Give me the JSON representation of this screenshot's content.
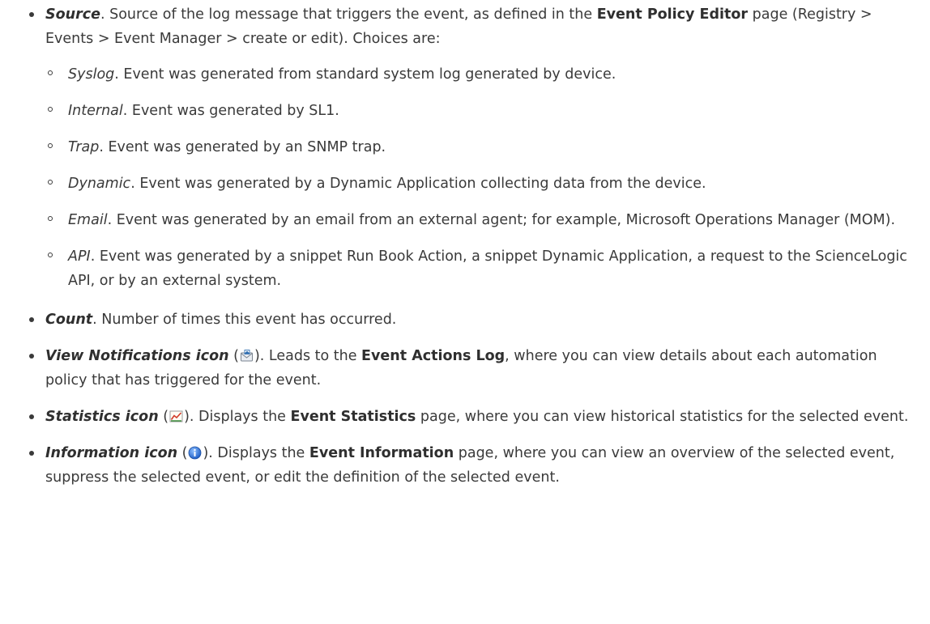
{
  "items": {
    "source": {
      "term": "Source",
      "text_a": ". Source of the log message that triggers the event, as defined in the ",
      "ui": "Event Policy Editor",
      "text_b": " page (Registry > Events > Event Manager > create or edit). Choices are:",
      "subitems": [
        {
          "term": "Syslog",
          "text": ". Event was generated from standard system log generated by device."
        },
        {
          "term": "Internal",
          "text": ". Event was generated by SL1."
        },
        {
          "term": "Trap",
          "text": ". Event was generated by an SNMP trap."
        },
        {
          "term": "Dynamic",
          "text": ". Event was generated by a Dynamic Application collecting data from the device."
        },
        {
          "term": "Email",
          "text": ". Event was generated by an email from an external agent; for example, Microsoft Operations Manager (MOM)."
        },
        {
          "term": "API",
          "text": ". Event was generated by a snippet Run Book Action, a snippet Dynamic Application, a request to the ScienceLogic API, or by an external system."
        }
      ]
    },
    "count": {
      "term": "Count",
      "text": ". Number of times this event has occurred."
    },
    "view_notifications": {
      "term": "View Notifications icon",
      "paren_open": " (",
      "icon": "notification-envelope-icon",
      "text_a": "). Leads to the ",
      "ui": "Event Actions Log",
      "text_b": ", where you can view details about each automation policy that has triggered for the event."
    },
    "statistics": {
      "term": "Statistics icon",
      "paren_open": " (",
      "icon": "statistics-chart-icon",
      "text_a": "). Displays the ",
      "ui": "Event Statistics",
      "text_b": " page, where you can view historical statistics for the selected event."
    },
    "information": {
      "term": "Information icon",
      "paren_open": " (",
      "icon": "information-icon",
      "text_a": "). Displays the ",
      "ui": "Event Information",
      "text_b": " page, where you can view an overview of the selected event, suppress the selected event, or edit the definition of the selected event."
    }
  }
}
